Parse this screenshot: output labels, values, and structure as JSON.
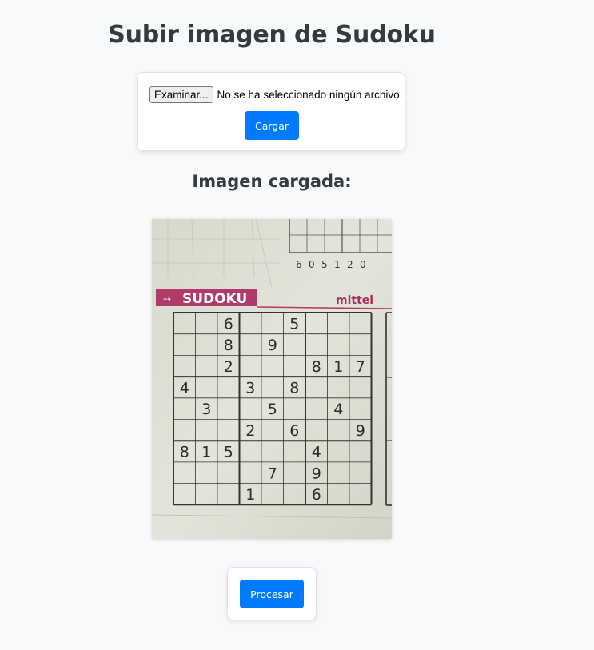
{
  "page": {
    "title": "Subir imagen de Sudoku"
  },
  "upload_form": {
    "browse_label": "Examinar...",
    "file_status": "No se ha seleccionado ningún archivo.",
    "submit_label": "Cargar"
  },
  "preview": {
    "heading": "Imagen cargada:",
    "photo": {
      "banner_text": "SUDOKU",
      "brand_text": "mittel",
      "top_digits": [
        "6",
        "0",
        "5",
        "1",
        "2",
        "0"
      ],
      "grid": [
        [
          "",
          "",
          "6",
          "",
          "",
          "5",
          "",
          "",
          ""
        ],
        [
          "",
          "",
          "8",
          "",
          "9",
          "",
          "",
          "",
          ""
        ],
        [
          "",
          "",
          "2",
          "",
          "",
          "",
          "8",
          "1",
          "7"
        ],
        [
          "4",
          "",
          "",
          "3",
          "",
          "8",
          "",
          "",
          ""
        ],
        [
          "",
          "3",
          "",
          "",
          "5",
          "",
          "",
          "4",
          ""
        ],
        [
          "",
          "",
          "",
          "2",
          "",
          "6",
          "",
          "",
          "9"
        ],
        [
          "8",
          "1",
          "5",
          "",
          "",
          "",
          "4",
          "",
          ""
        ],
        [
          "",
          "",
          "",
          "",
          "7",
          "",
          "9",
          "",
          ""
        ],
        [
          "",
          "",
          "",
          "1",
          "",
          "",
          "6",
          "",
          ""
        ]
      ]
    }
  },
  "actions": {
    "process_label": "Procesar"
  },
  "colors": {
    "primary": "#007bff",
    "page_background": "#f8f9fa",
    "heading_text": "#343a40",
    "banner": "#b03a6a"
  }
}
